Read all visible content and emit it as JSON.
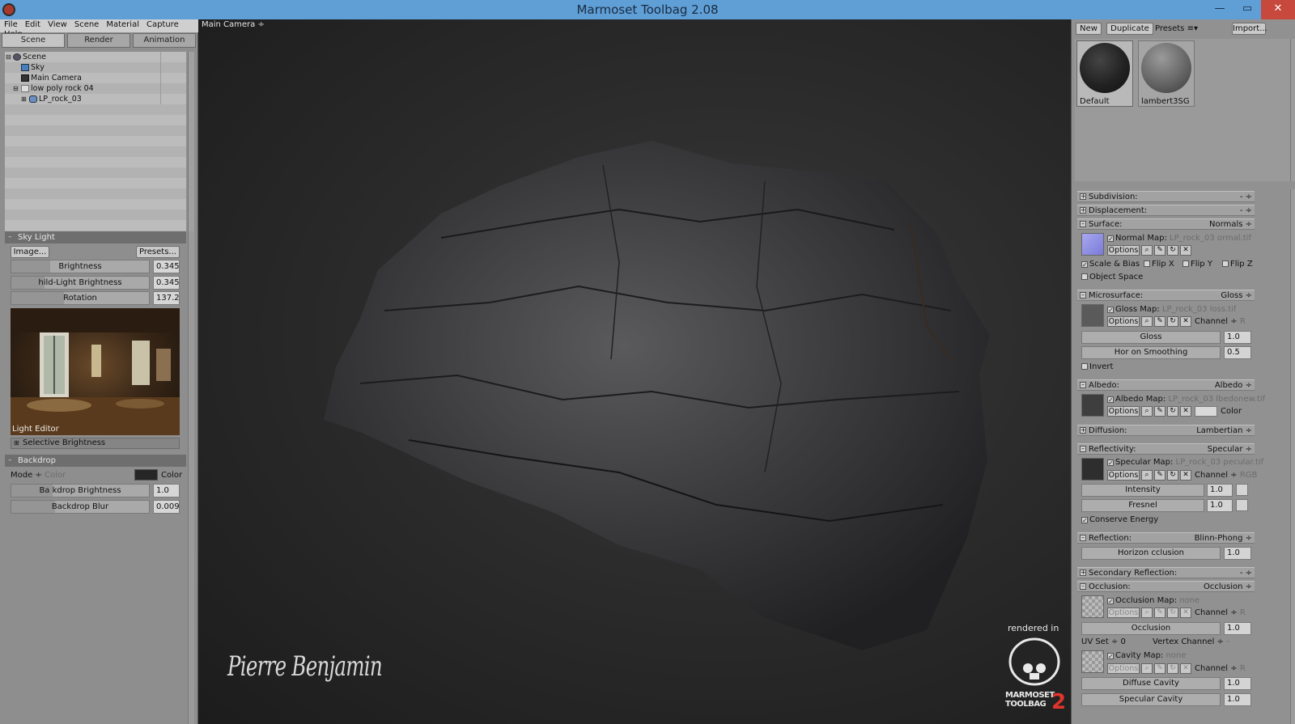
{
  "window": {
    "title": "Marmoset Toolbag 2.08",
    "min": "—",
    "max": "▭",
    "close": "✕"
  },
  "menu": [
    "File",
    "Edit",
    "View",
    "Scene",
    "Material",
    "Capture",
    "Help"
  ],
  "left_tabs": [
    "Scene",
    "Render",
    "Animation"
  ],
  "active_left_tab": "Scene",
  "scene_tree": [
    {
      "label": "Scene",
      "icon": "scene-icon",
      "indent": 0
    },
    {
      "label": "Sky",
      "icon": "sky-icon",
      "indent": 1
    },
    {
      "label": "Main Camera",
      "icon": "camera-icon",
      "indent": 1
    },
    {
      "label": "low poly rock 04",
      "icon": "group-icon",
      "indent": 1
    },
    {
      "label": "LP_rock_03",
      "icon": "mesh-icon",
      "indent": 2
    }
  ],
  "sky_light": {
    "title": "Sky Light",
    "image_button": "Image...",
    "presets_button": "Presets...",
    "brightness_label": "Brightness",
    "brightness_value": "0.345",
    "child_light_label": "hild-Light Brightness",
    "child_light_value": "0.345",
    "rotation_label": "Rotation",
    "rotation_value": "137.2",
    "light_editor_label": "Light Editor",
    "selective_brightness": "Selective Brightness"
  },
  "backdrop": {
    "title": "Backdrop",
    "mode_label": "Mode ÷",
    "mode_value": "Color",
    "color_label": "Color",
    "brightness_label": "Ba  kdrop Brightness",
    "brightness_value": "1.0",
    "blur_label": "Backdrop Blur",
    "blur_value": "0.009"
  },
  "viewport": {
    "camera_select": "Main Camera ÷",
    "signature": "Pierre Benjamin",
    "rendered_in": "rendered in",
    "logo_text_1": "MARMOSET",
    "logo_text_2": "TOOLBAG",
    "logo_number": "2"
  },
  "materials_toolbar": {
    "new": "New",
    "duplicate": "Duplicate",
    "presets": "Presets ≡▾",
    "import": "Import..."
  },
  "materials": [
    {
      "name": "Default",
      "selected": true
    },
    {
      "name": "lambert3SG",
      "selected": false
    }
  ],
  "sections": {
    "subdivision": {
      "name": "Subdivision:",
      "value": "- ÷"
    },
    "displacement": {
      "name": "Displacement:",
      "value": "- ÷"
    },
    "surface": {
      "name": "Surface:",
      "value": "Normals ÷"
    },
    "microsurface": {
      "name": "Microsurface:",
      "value": "Gloss ÷"
    },
    "albedo": {
      "name": "Albedo:",
      "value": "Albedo ÷"
    },
    "diffusion": {
      "name": "Diffusion:",
      "value": "Lambertian ÷"
    },
    "reflectivity": {
      "name": "Reflectivity:",
      "value": "Specular ÷"
    },
    "reflection": {
      "name": "Reflection:",
      "value": "Blinn-Phong ÷"
    },
    "secondary_reflection": {
      "name": "Secondary Reflection:",
      "value": "- ÷"
    },
    "occlusion": {
      "name": "Occlusion:",
      "value": "Occlusion ÷"
    }
  },
  "surface": {
    "map_label": "Normal Map:",
    "map_file": "LP_rock_03 ormal.tif",
    "options": "Options",
    "scale_bias": "Scale & Bias",
    "flip_x": "Flip X",
    "flip_y": "Flip Y",
    "flip_z": "Flip Z",
    "object_space": "Object Space"
  },
  "microsurface": {
    "map_label": "Gloss Map:",
    "map_file": "LP_rock_03 loss.tif",
    "options": "Options",
    "channel_label": "Channel ÷",
    "channel_value": "R",
    "gloss_label": "Gloss",
    "gloss_value": "1.0",
    "horizon_label": "Hor  on Smoothing",
    "horizon_value": "0.5",
    "invert": "Invert"
  },
  "albedo": {
    "map_label": "Albedo Map:",
    "map_file": "LP_rock_03 lbedonew.tif",
    "options": "Options",
    "color_label": "Color"
  },
  "reflectivity": {
    "map_label": "Specular Map:",
    "map_file": "LP_rock_03 pecular.tif",
    "options": "Options",
    "channel_label": "Channel ÷",
    "channel_value": "RGB",
    "intensity_label": "Intensity",
    "intensity_value": "1.0",
    "fresnel_label": "Fresnel",
    "fresnel_value": "1.0",
    "conserve": "Conserve Energy"
  },
  "reflection": {
    "horizon_label": "Horizon  cclusion",
    "horizon_value": "1.0"
  },
  "occlusion": {
    "map_label": "Occlusion Map:",
    "map_file": "none",
    "options": "Options",
    "channel_label": "Channel ÷",
    "channel_value": "R",
    "occlusion_label": "Occlusion",
    "occlusion_value": "1.0",
    "uv_set": "UV Set ÷ 0",
    "vertex_channel": "Vertex Channel ÷",
    "vertex_value": "-",
    "cavity_label": "Cavity Map:",
    "cavity_file": "none",
    "cavity_options": "Options",
    "cavity_channel": "Channel ÷",
    "cavity_channel_value": "R",
    "diffuse_cavity_label": "Diffuse Cavity",
    "diffuse_cavity_value": "1.0",
    "specular_cavity_label": "Specular Cavity",
    "specular_cavity_value": "1.0"
  },
  "colors": {
    "titlebar": "#5f9fd6",
    "close": "#c7483d",
    "panel": "#8e8e8e"
  }
}
